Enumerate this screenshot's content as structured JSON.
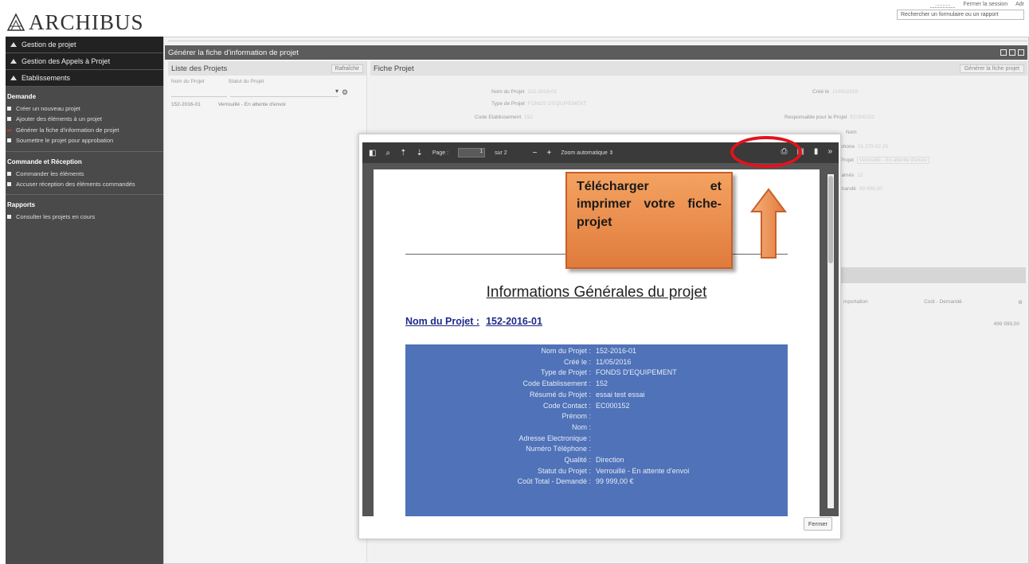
{
  "app": {
    "logo_text": "ARCHIBUS"
  },
  "header": {
    "username": "..........",
    "logout": "Fermer la session",
    "user_short": "Adr",
    "search_placeholder": "Rechercher un formulaire ou un rapport"
  },
  "sidebar": {
    "groups": [
      {
        "label": "Gestion de projet"
      },
      {
        "label": "Gestion des Appels à Projet"
      },
      {
        "label": "Etablissements"
      }
    ],
    "sections": [
      {
        "title": "Demande",
        "items": [
          {
            "label": "Créer un nouveau projet"
          },
          {
            "label": "Ajouter des éléments à un projet"
          },
          {
            "label": "Générer la fiche d'information de projet"
          },
          {
            "label": "Soumettre le projet pour approbation"
          }
        ]
      },
      {
        "title": "Commande et Réception",
        "items": [
          {
            "label": "Commander les éléments"
          },
          {
            "label": "Accuser réception des éléments commandés"
          }
        ]
      },
      {
        "title": "Rapports",
        "items": [
          {
            "label": "Consulter les projets en cours"
          }
        ]
      }
    ]
  },
  "main": {
    "title": "Générer la fiche d'information de projet"
  },
  "list": {
    "title": "Liste des Projets",
    "refresh": "Rafraîchir",
    "columns": [
      "Nom du Projet",
      "Statut du Projet"
    ],
    "rows": [
      {
        "name": "152-2016-01",
        "status": "Verrouillé - En attente d'envoi"
      }
    ]
  },
  "form": {
    "title": "Fiche Projet",
    "generate": "Générer la fiche projet",
    "fields": {
      "nom": {
        "label": "Nom du Projet",
        "value": "152-2016-01"
      },
      "type": {
        "label": "Type de Projet",
        "value": "FONDS D'EQUIPEMENT"
      },
      "code": {
        "label": "Code Etablissement",
        "value": "152"
      },
      "cree": {
        "label": "Créé le",
        "value": "11/05/2016"
      },
      "resp": {
        "label": "Responsable pour le Projet",
        "value": "EC000152"
      },
      "nom2": {
        "label": "Nom",
        "value": ""
      },
      "tel": {
        "label": "phone",
        "value": "01 279 02 25"
      },
      "statut": {
        "label": "Projet",
        "value": "Verrouillé - En attente d'envoi"
      },
      "pren": {
        "label": "lamés",
        "value": "12"
      },
      "dem": {
        "label": "mandé",
        "value": "99 999,00"
      }
    },
    "sub_table": {
      "col1": "mportation",
      "col2": "Coût - Demandé",
      "total": "499 999,00"
    }
  },
  "viewer": {
    "page_label": "Page :",
    "page_value": "1",
    "page_total": "sur 2",
    "zoom": "Zoom automatique",
    "close": "Fermer"
  },
  "document": {
    "title": "Informations Générales du projet",
    "name_label": "Nom du Projet :",
    "name_value": "152-2016-01",
    "rows": [
      {
        "k": "Nom du Projet",
        "v": "152-2016-01"
      },
      {
        "k": "Créé le",
        "v": "11/05/2016"
      },
      {
        "k": "Type de Projet",
        "v": "FONDS D'EQUIPEMENT"
      },
      {
        "k": "Code Etablissement",
        "v": "152"
      },
      {
        "k": "Résumé du Projet",
        "v": "essai test essai"
      },
      {
        "k": "Code Contact",
        "v": "EC000152"
      },
      {
        "k": "Prénom",
        "v": ""
      },
      {
        "k": "Nom",
        "v": ""
      },
      {
        "k": "Adresse Electronique",
        "v": ""
      },
      {
        "k": "Numéro Téléphone",
        "v": ""
      },
      {
        "k": "Qualité",
        "v": "Direction"
      },
      {
        "k": "Statut du Projet",
        "v": "Verrouillé - En attente d'envoi"
      },
      {
        "k": "Coût Total - Demandé",
        "v": "99 999,00 €"
      }
    ]
  },
  "annotation": {
    "text": "Télécharger et imprimer votre fiche-projet",
    "colors": {
      "fill": "#e88a4a",
      "ring": "#e3121c"
    }
  }
}
